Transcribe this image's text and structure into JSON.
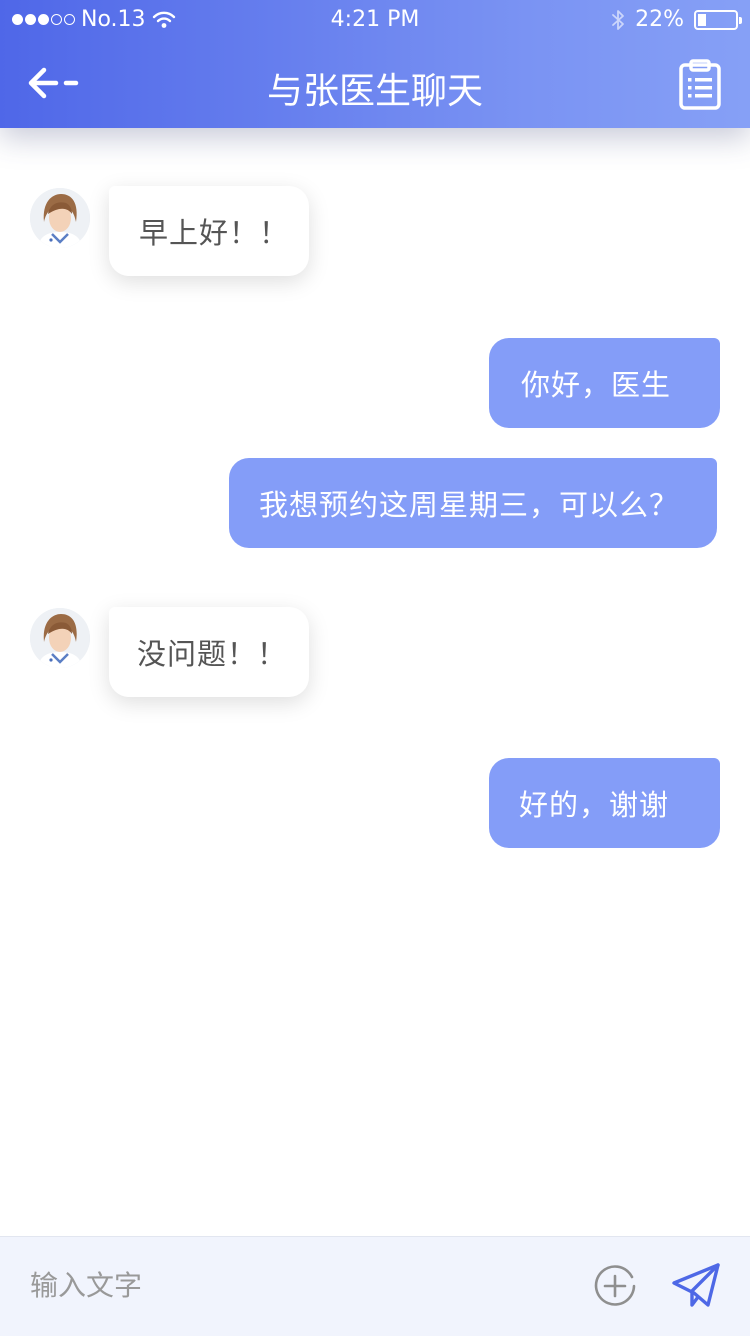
{
  "status_bar": {
    "carrier": "No.13",
    "time": "4:21 PM",
    "battery": "22%",
    "battery_level": 0.22,
    "icons": [
      "signal-dots-icon",
      "wifi-icon",
      "bluetooth-icon",
      "battery-icon"
    ]
  },
  "header": {
    "title": "与张医生聊天",
    "back_icon": "arrow-left-icon",
    "action_icon": "clipboard-list-icon"
  },
  "messages": [
    {
      "sender": "doctor",
      "text": "早上好！！"
    },
    {
      "sender": "me",
      "text": "你好，医生"
    },
    {
      "sender": "me",
      "text": "我想预约这周星期三，可以么？"
    },
    {
      "sender": "doctor",
      "text": "没问题！！"
    },
    {
      "sender": "me",
      "text": "好的，谢谢"
    }
  ],
  "input_bar": {
    "placeholder": "输入文字",
    "add_icon": "plus-circle-icon",
    "send_icon": "send-icon"
  },
  "colors": {
    "header_start": "#4f67e8",
    "header_end": "#86a0f6",
    "outgoing_bubble": "#849df8",
    "incoming_bubble": "#ffffff",
    "send_icon": "#4e68e6",
    "input_bar_bg": "#f1f4fd"
  }
}
